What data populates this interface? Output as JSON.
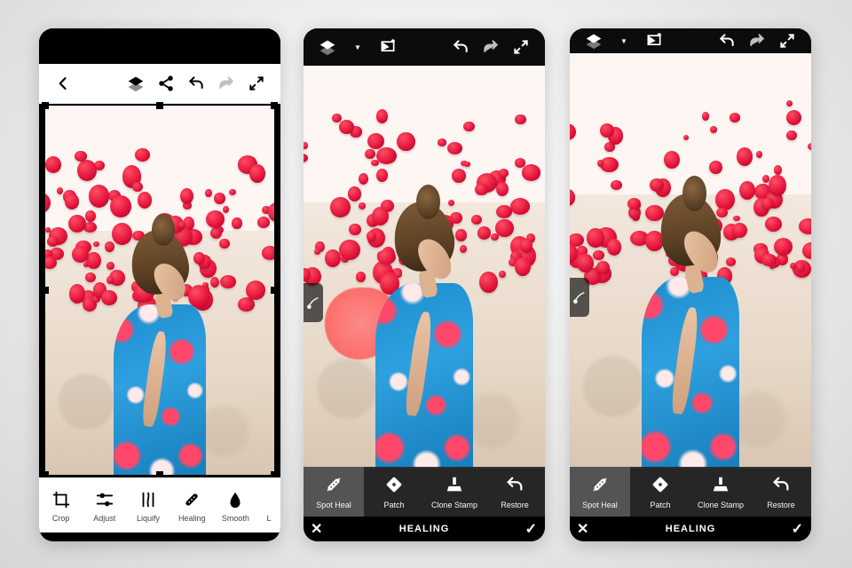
{
  "icons": {
    "back": "back-icon",
    "layers": "layers-icon",
    "share": "share-icon",
    "undo": "undo-icon",
    "redo": "redo-icon",
    "fullscreen": "fullscreen-icon",
    "autofix": "autofix-icon",
    "brush": "brush-icon"
  },
  "phone1": {
    "theme": "light",
    "topbar_icons": [
      "layers",
      "share",
      "undo",
      "redo",
      "fullscreen"
    ],
    "redo_enabled": false,
    "toolbar": [
      {
        "name": "crop",
        "label": "Crop"
      },
      {
        "name": "adjust",
        "label": "Adjust"
      },
      {
        "name": "liquify",
        "label": "Liquify"
      },
      {
        "name": "healing",
        "label": "Healing",
        "selected": true
      },
      {
        "name": "smooth",
        "label": "Smooth"
      },
      {
        "name": "more",
        "label": "L"
      }
    ]
  },
  "phone2": {
    "theme": "dark",
    "mode_title": "HEALING",
    "topbar_left": [
      "layers",
      "autofix"
    ],
    "topbar_right": [
      "undo",
      "redo",
      "fullscreen"
    ],
    "redo_enabled": false,
    "heal_overlay": true,
    "tools": [
      {
        "name": "spot-heal",
        "label": "Spot Heal",
        "selected": true
      },
      {
        "name": "patch",
        "label": "Patch"
      },
      {
        "name": "clone-stamp",
        "label": "Clone Stamp"
      },
      {
        "name": "restore",
        "label": "Restore"
      }
    ],
    "confirm": {
      "cancel": "✕",
      "accept": "✓"
    }
  },
  "phone3": {
    "theme": "dark",
    "mode_title": "HEALING",
    "topbar_left": [
      "layers",
      "autofix"
    ],
    "topbar_right": [
      "undo",
      "redo",
      "fullscreen"
    ],
    "redo_enabled": false,
    "heal_overlay": false,
    "tools": [
      {
        "name": "spot-heal",
        "label": "Spot Heal",
        "selected": true
      },
      {
        "name": "patch",
        "label": "Patch"
      },
      {
        "name": "clone-stamp",
        "label": "Clone Stamp"
      },
      {
        "name": "restore",
        "label": "Restore"
      }
    ],
    "confirm": {
      "cancel": "✕",
      "accept": "✓"
    }
  }
}
